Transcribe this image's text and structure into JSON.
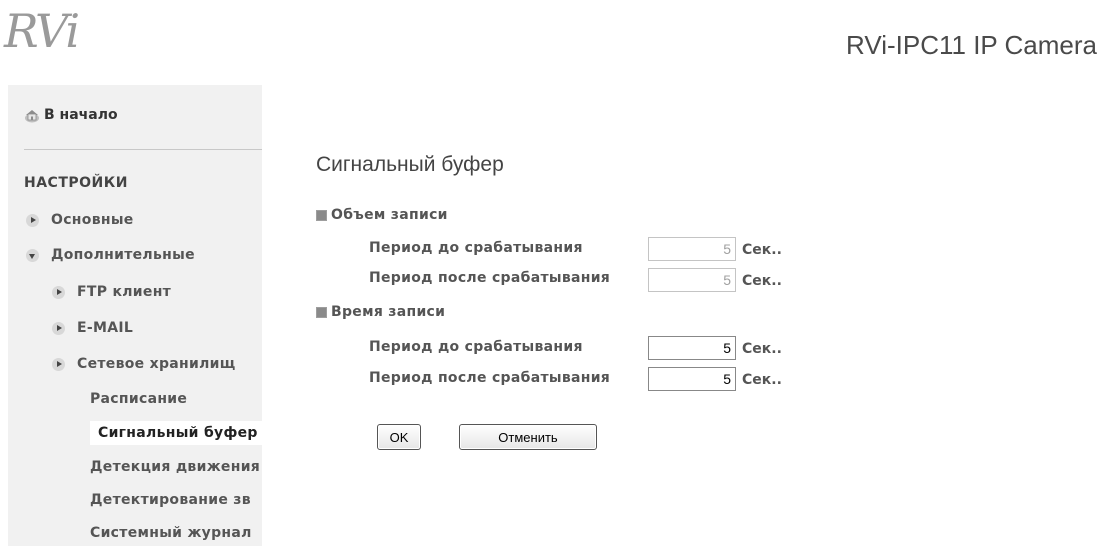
{
  "header": {
    "logo_text": "RVi",
    "product_title": "RVi-IPC11 IP Camera"
  },
  "sidebar": {
    "home_label": "В начало",
    "section_title": "НАСТРОЙКИ",
    "menu": [
      {
        "label": "Основные",
        "expanded": false
      },
      {
        "label": "Дополнительные",
        "expanded": true
      }
    ],
    "submenu": [
      {
        "label": "FTP клиент"
      },
      {
        "label": "E-MAIL"
      },
      {
        "label": "Сетевое хранилищ"
      }
    ],
    "leaf_items": [
      {
        "label": "Расписание"
      },
      {
        "label": "Сигнальный буфер",
        "active": true
      },
      {
        "label": "Детекция движения"
      },
      {
        "label": "Детектирование зв"
      },
      {
        "label": "Системный журнал"
      }
    ],
    "colors": {
      "background": "#f1f1f1",
      "active_item": "#ffffff"
    }
  },
  "main": {
    "title": "Сигнальный буфер",
    "groups": [
      {
        "title": "Объем записи",
        "rows": [
          {
            "label": "Период до срабатывания",
            "value": "5",
            "unit": "Сек..",
            "disabled": true
          },
          {
            "label": "Период после срабатывания",
            "value": "5",
            "unit": "Сек..",
            "disabled": true
          }
        ]
      },
      {
        "title": "Время записи",
        "rows": [
          {
            "label": "Период до срабатывания",
            "value": "5",
            "unit": "Сек..",
            "disabled": false
          },
          {
            "label": "Период после срабатывания",
            "value": "5",
            "unit": "Сек..",
            "disabled": false
          }
        ]
      }
    ],
    "buttons": {
      "ok_label": "OK",
      "cancel_label": "Отменить"
    }
  },
  "icons": {
    "home": "home-icon",
    "collapsed": "arrow-right-icon",
    "expanded": "arrow-down-icon",
    "group_bullet": "square-bullet-icon"
  }
}
